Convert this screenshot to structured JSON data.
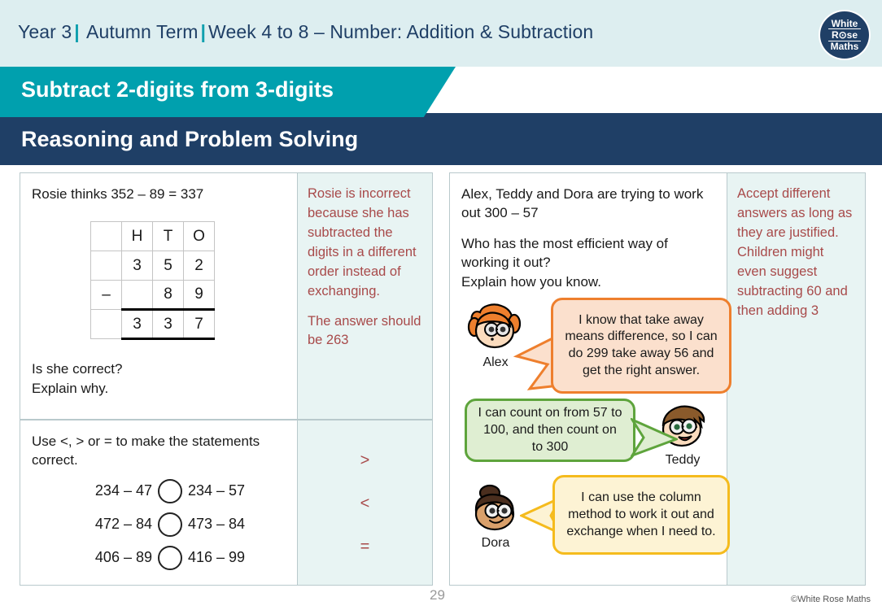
{
  "header": {
    "year": "Year 3",
    "term": "Autumn Term",
    "week": "Week 4 to 8 – Number: Addition & Subtraction",
    "separator": "|",
    "logo": {
      "line1": "White",
      "line2": "R⊙se",
      "line3": "Maths"
    }
  },
  "banner": {
    "lesson_title": "Subtract 2-digits from 3-digits",
    "section_title": "Reasoning and Problem Solving"
  },
  "questions": {
    "q1": {
      "prompt": "Rosie thinks 352 – 89 = 337",
      "table": {
        "headers": [
          "",
          "H",
          "T",
          "O"
        ],
        "rows": [
          [
            "",
            "3",
            "5",
            "2"
          ],
          [
            "–",
            "",
            "8",
            "9"
          ],
          [
            "",
            "3",
            "3",
            "7"
          ]
        ]
      },
      "follow_up_line1": "Is she correct?",
      "follow_up_line2": "Explain why.",
      "answer_p1": "Rosie is incorrect because she has subtracted the digits in a different order instead of exchanging.",
      "answer_p2": "The answer should be 263"
    },
    "q2": {
      "prompt_line1": "Use <, > or = to make the statements",
      "prompt_line2": "correct.",
      "statements": [
        {
          "left": "234 – 47",
          "right": "234 – 57",
          "answer": ">"
        },
        {
          "left": "472 – 84",
          "right": "473 – 84",
          "answer": "<"
        },
        {
          "left": "406 – 89",
          "right": "416 – 99",
          "answer": "="
        }
      ]
    },
    "q3": {
      "prompt_line1": "Alex, Teddy and Dora are trying to work",
      "prompt_line2": "out 300 – 57",
      "prompt_line3": "Who has the most efficient way of",
      "prompt_line4": "working it out?",
      "prompt_line5": "Explain how you know.",
      "characters": [
        {
          "name": "Alex",
          "speech": "I know that take away means difference, so I can do 299 take away 56 and get the right answer.",
          "bubble_color": "#ee7f2d"
        },
        {
          "name": "Teddy",
          "speech": "I can count on from 57 to 100, and then count on to 300",
          "bubble_color": "#5ea43c"
        },
        {
          "name": "Dora",
          "speech": "I can use the column method to work it out and exchange when I need to.",
          "bubble_color": "#f5bb1d"
        }
      ],
      "answer": "Accept different answers as long as they are justified. Children might even suggest subtracting 60 and then adding 3"
    }
  },
  "footer": {
    "page_number": "29",
    "copyright": "©White Rose Maths"
  },
  "colors": {
    "header_bg": "#ddeef0",
    "teal": "#00a0ae",
    "navy": "#1f3f66",
    "answer_text": "#a84a4a",
    "answer_bg": "#e8f4f3"
  }
}
